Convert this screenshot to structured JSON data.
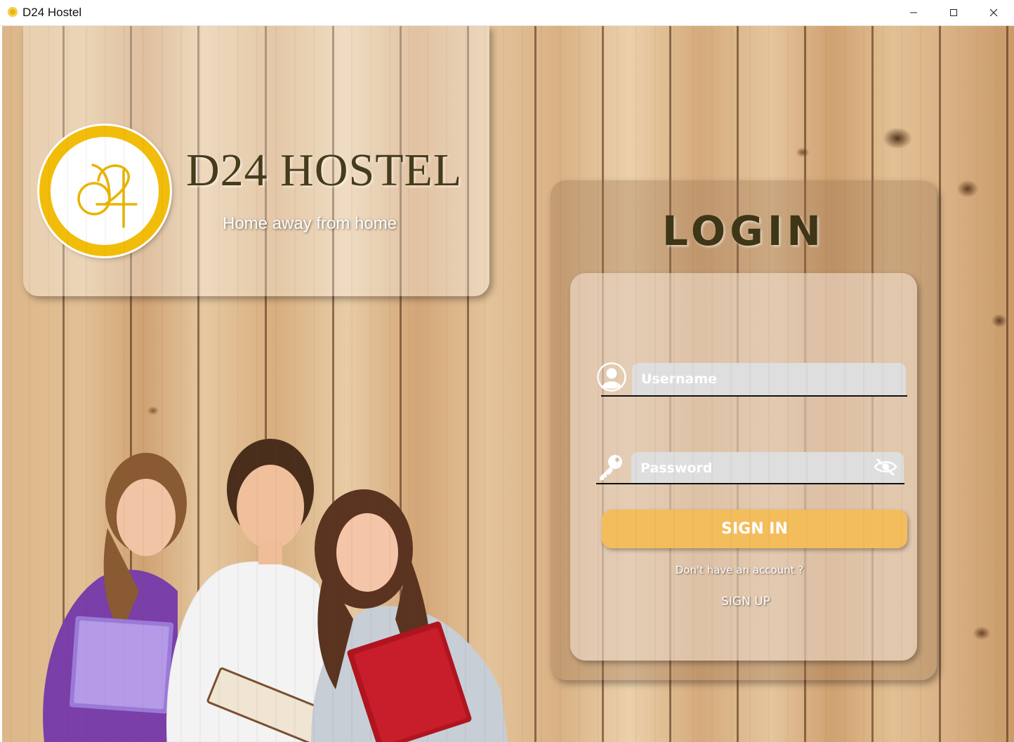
{
  "window": {
    "title": "D24 Hostel",
    "controls": [
      "minimize",
      "maximize",
      "close"
    ]
  },
  "brand": {
    "name": "D24 HOSTEL",
    "tagline": "Home away from home",
    "logo_icon": "d24-monogram-logo",
    "accent_color": "#f2bd0a"
  },
  "login": {
    "title": "LOGIN",
    "username": {
      "placeholder": "Username",
      "value": "",
      "icon": "user-icon"
    },
    "password": {
      "placeholder": "Password",
      "value": "",
      "icon": "key-icon",
      "toggle_icon": "eye-off-icon"
    },
    "sign_in_label": "SIGN IN",
    "no_account_text": "Don't have an account ?",
    "sign_up_label": "SIGN UP",
    "button_color": "#f4bd5c"
  },
  "hero_image": "students-holding-books"
}
